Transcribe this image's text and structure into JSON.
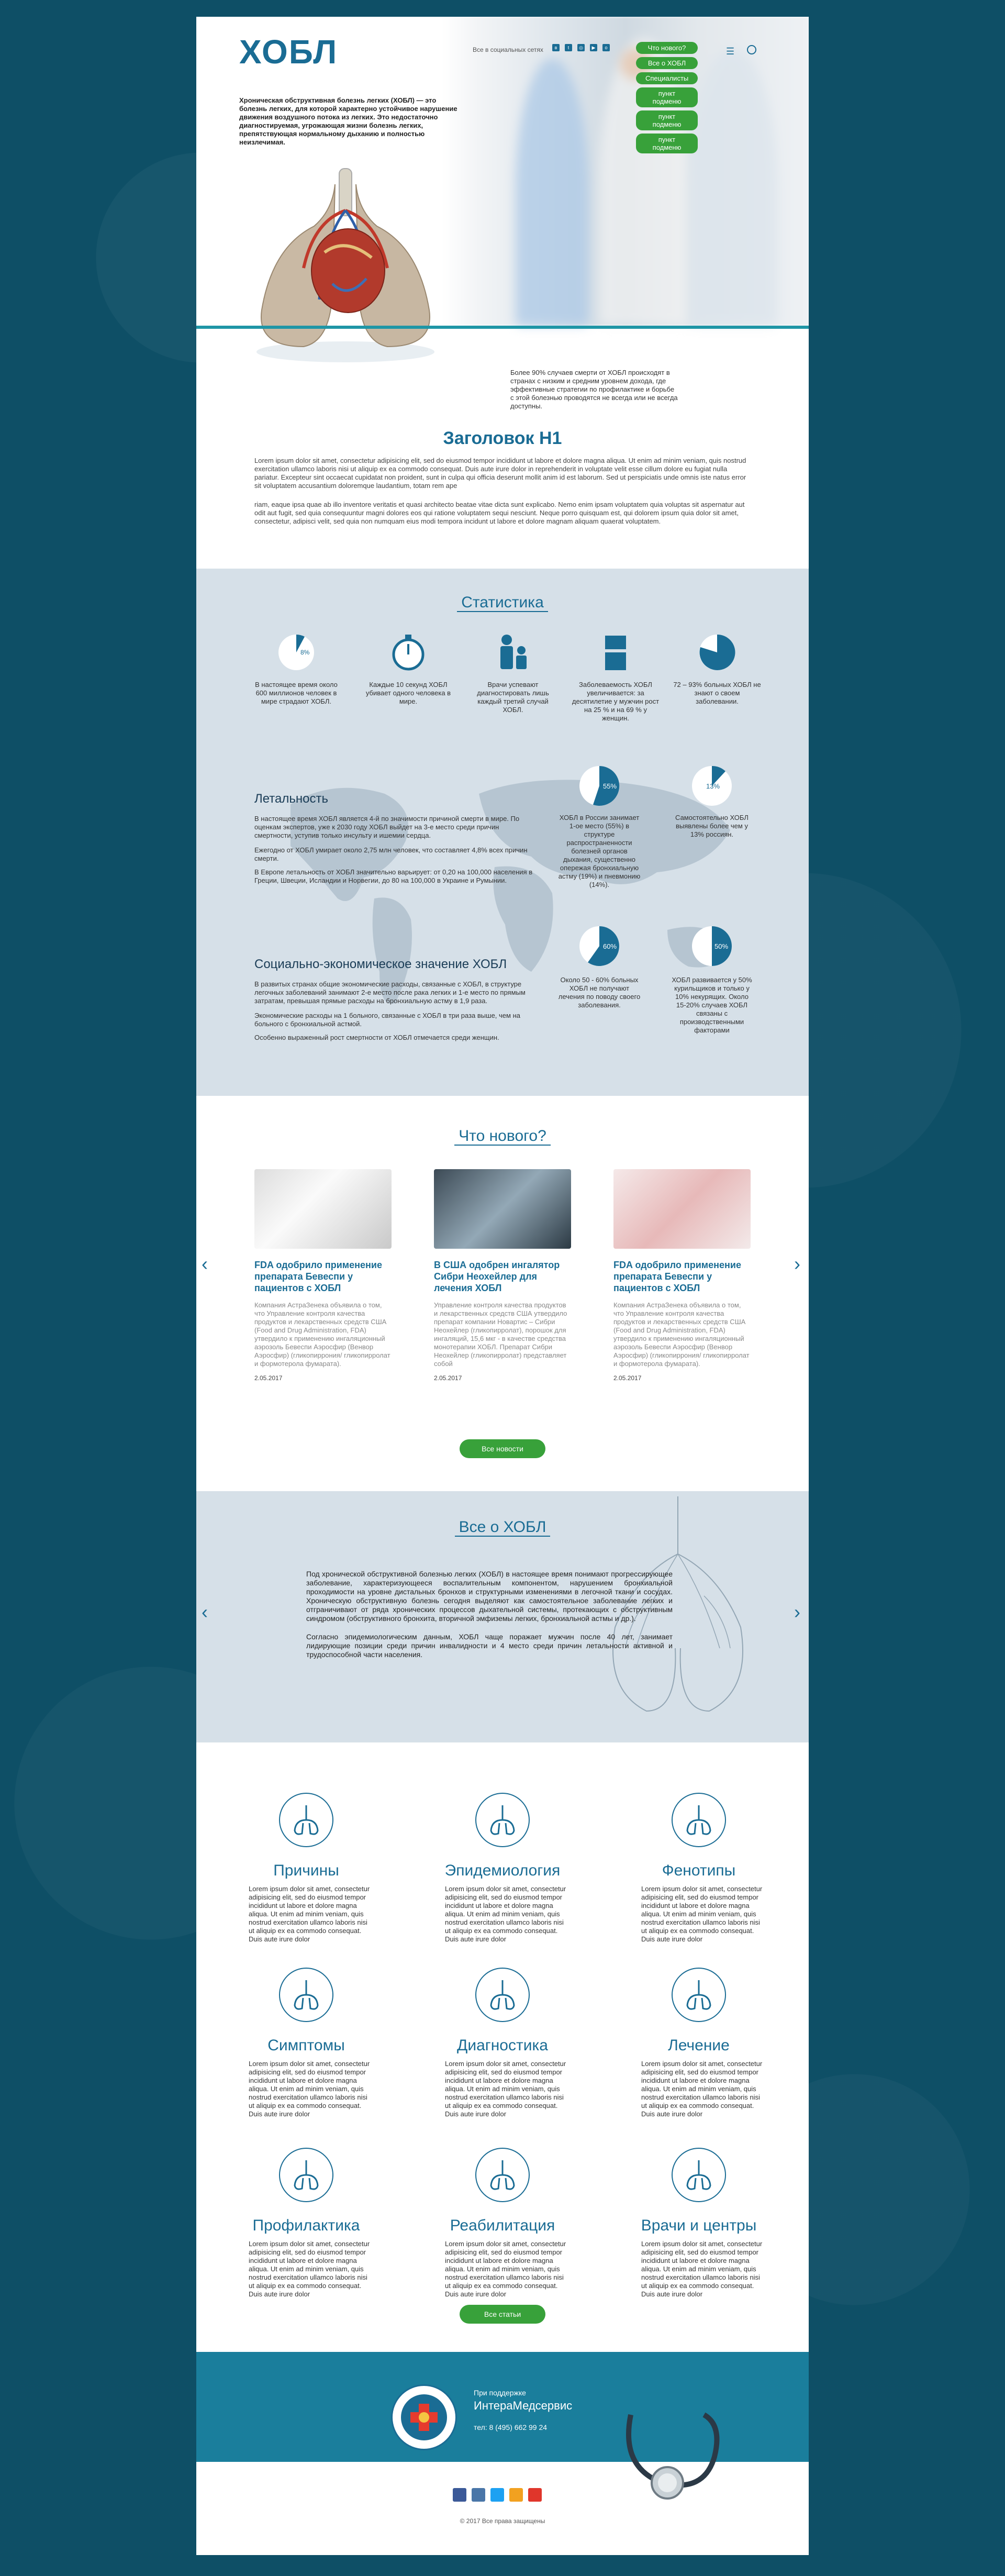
{
  "header": {
    "logo": "ХОБЛ",
    "intro": "Хроническая обструктивная болезнь легких (ХОБЛ) — это болезнь легких, для которой характерно устойчивое нарушение движения воздушного потока из легких. Это недостаточно диагностируемая, угрожающая жизни болезнь легких, препятствующая нормальному дыханию и полностью неизлечимая.",
    "social_label": "Все в социальных сетях",
    "menu": [
      "Что нового?",
      "Все о ХОБЛ",
      "Специалисты",
      "пункт подменю",
      "пункт подменю",
      "пункт подменю"
    ],
    "quote": "Более 90% случаев смерти от ХОБЛ происходят в странах с низким и средним уровнем дохода, где эффективные стратегии по профилактике и борьбе с этой болезнью проводятся не всегда или не всегда доступны."
  },
  "h1": {
    "title": "Заголовок Н1",
    "p1": "Lorem ipsum dolor sit amet, consectetur adipisicing elit, sed do eiusmod tempor incididunt ut labore et dolore magna aliqua. Ut enim ad minim veniam, quis nostrud exercitation ullamco laboris nisi ut aliquip ex ea commodo consequat. Duis aute irure dolor in reprehenderit in voluptate velit esse cillum dolore eu fugiat nulla pariatur. Excepteur sint occaecat cupidatat non proident, sunt in culpa qui officia deserunt mollit anim id est laborum. Sed ut perspiciatis unde omnis iste natus error sit voluptatem accusantium doloremque laudantium, totam rem ape",
    "p2": "riam, eaque ipsa quae ab illo inventore veritatis et quasi architecto beatae vitae dicta sunt explicabo. Nemo enim ipsam voluptatem quia voluptas sit aspernatur aut odit aut fugit, sed quia consequuntur magni dolores eos qui ratione voluptatem sequi nesciunt. Neque porro quisquam est, qui dolorem ipsum quia dolor sit amet, consectetur, adipisci velit, sed quia non numquam eius modi tempora incidunt ut labore et dolore magnam aliquam quaerat voluptatem."
  },
  "stats": {
    "title": "Статистика",
    "items": [
      {
        "label": "8%",
        "text": "В настоящее время около 600 миллионов человек в мире страдают ХОБЛ."
      },
      {
        "label": "",
        "text": "Каждые 10 секунд ХОБЛ убивает одного человека в мире."
      },
      {
        "label": "",
        "text": "Врачи успевают диагностировать лишь каждый третий случай ХОБЛ."
      },
      {
        "label": "25% / 69%",
        "text": "Заболеваемость ХОБЛ увеличивается: за десятилетие у мужчин рост на 25 % и на 69 % у женщин."
      },
      {
        "label": "72% / 93%",
        "text": "72 – 93% больных ХОБЛ не знают о своем заболевании."
      }
    ],
    "mortality_title": "Летальность",
    "mortality_p1": "В настоящее время ХОБЛ является 4-й по значимости причиной смерти в мире. По оценкам экспертов, уже к 2030 году ХОБЛ выйдет на 3-е место среди причин смертности, уступив только инсульту и ишемии сердца.",
    "mortality_p2": "Ежегодно от ХОБЛ умирает около 2,75 млн человек, что составляет 4,8% всех причин смерти.",
    "mortality_p3": "В Европе летальность от ХОБЛ значительно варьирует: от 0,20 на 100,000 населения в Греции, Швеции, Исландии и Норвегии, до 80 на 100,000 в Украине и Румынии.",
    "pies": [
      {
        "pct": "55%",
        "text": "ХОБЛ в России занимает 1-ое место (55%) в структуре распространенности болезней органов дыхания, существенно опережая бронхиальную астму (19%) и пневмонию (14%)."
      },
      {
        "pct": "13%",
        "text": "Самостоятельно ХОБЛ выявлены более чем у 13% россиян."
      },
      {
        "pct": "60%",
        "text": "Около 50 - 60% больных ХОБЛ не получают лечения по поводу своего заболевания."
      },
      {
        "pct": "50%",
        "text": "ХОБЛ развивается у 50% курильщиков и только у 10% некурящих. Около 15-20% случаев ХОБЛ связаны с производственными факторами"
      }
    ],
    "socio_title": "Социально-экономическое значение ХОБЛ",
    "socio_p1": "В развитых странах общие экономические расходы, связанные с ХОБЛ, в структуре легочных заболеваний занимают 2-е место после рака легких и 1-е место по прямым затратам, превышая прямые расходы на бронхиальную астму в 1,9 раза.",
    "socio_p2": "Экономические расходы на 1 больного, связанные с ХОБЛ в три раза выше, чем на больного с бронхиальной астмой.",
    "socio_p3": "Особенно выраженный рост смертности от ХОБЛ отмечается среди женщин."
  },
  "news": {
    "title": "Что нового?",
    "items": [
      {
        "headline": "FDA одобрило применение препарата Бевеспи у пациентов с ХОБЛ",
        "body": "Компания АстраЗенека объявила о том, что Управление контроля качества продуктов и лекарственных средств США (Food and Drug Administration, FDA) утвердило к применению ингаляционный аэрозоль Бевеспи Аэросфир (Венвор Аэросфир) (гликопиррония/ гликопирролат и формотерола фумарата).",
        "date": "2.05.2017"
      },
      {
        "headline": "В США одобрен ингалятор Сибри Неохейлер для лечения ХОБЛ",
        "body": "Управление контроля качества продуктов и лекарственных средств США утвердило препарат компании Новартис – Сибри Неохейлер (гликопирролат), порошок для ингаляций, 15,6 мкг - в качестве средства монотерапии ХОБЛ. Препарат Сибри Неохейлер (гликопирролат) представляет собой",
        "date": "2.05.2017"
      },
      {
        "headline": "FDA одобрило применение препарата Бевеспи у пациентов с ХОБЛ",
        "body": "Компания АстраЗенека объявила о том, что Управление контроля качества продуктов и лекарственных средств США (Food and Drug Administration, FDA) утвердило к применению ингаляционный аэрозоль Бевеспи Аэросфир (Венвор Аэросфир) (гликопиррония/ гликопирролат и формотерола фумарата).",
        "date": "2.05.2017"
      }
    ],
    "all_button": "Все новости"
  },
  "about": {
    "title": "Все о ХОБЛ",
    "p1": "Под хронической обструктивной болезнью легких (ХОБЛ) в настоящее время понимают прогрессирующее заболевание, характеризующееся воспалительным компонентом, нарушением бронхиальной проходимости на уровне дистальных бронхов и структурными изменениями в легочной ткани и сосудах. Хроническую обструктивную болезнь сегодня выделяют как самостоятельное заболевание легких и отграничивают от ряда хронических процессов дыхательной системы, протекающих с обструктивным синдромом (обструктивного бронхита, вторичной эмфиземы легких, бронхиальной астмы и др.).",
    "p2": "Согласно эпидемиологическим данным, ХОБЛ чаще поражает мужчин после 40 лет, занимает лидирующие позиции среди причин инвалидности и 4 место среди причин летальности активной и трудоспособной части населения."
  },
  "topics": {
    "lorem": "Lorem ipsum dolor sit amet, consectetur adipisicing elit, sed do eiusmod tempor incididunt ut labore et dolore magna aliqua. Ut enim ad minim veniam, quis nostrud exercitation ullamco laboris nisi ut aliquip ex ea commodo consequat. Duis aute irure dolor",
    "items": [
      "Причины",
      "Эпидемиология",
      "Фенотипы",
      "Симптомы",
      "Диагностика",
      "Лечение",
      "Профилактика",
      "Реабилитация",
      "Врачи и центры"
    ],
    "all_button": "Все статьи"
  },
  "footer": {
    "support": "При поддержке",
    "company": "ИнтераМедсервис",
    "phone": "тел: 8 (495) 662 99 24",
    "copyright": "© 2017 Все права защищены"
  },
  "colors": {
    "brand": "#1a6c94",
    "accent_green": "#38a13a",
    "band": "#1a7e9c"
  }
}
